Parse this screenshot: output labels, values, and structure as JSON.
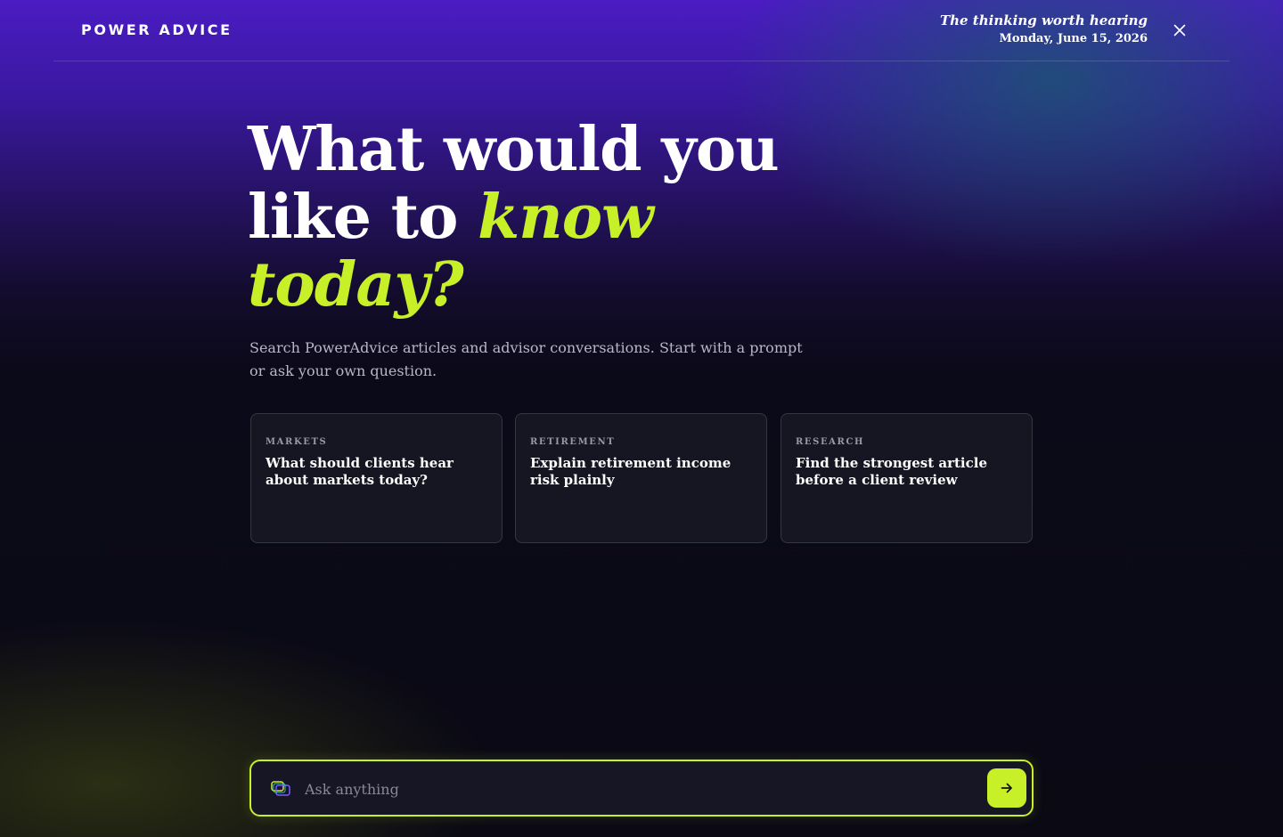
{
  "header": {
    "logo": "POWER ADVICE",
    "tagline": "The thinking worth hearing",
    "date": "Monday, June 15, 2026",
    "close_icon": "close-icon"
  },
  "hero": {
    "line1": "What would you",
    "line2_plain": "like to ",
    "line2_accent": "know",
    "line3_accent": "today?"
  },
  "subtitle": "Search PowerAdvice articles and advisor conversations. Start with a prompt or ask your own question.",
  "prompt_cards": [
    {
      "category": "MARKETS",
      "title": "What should clients hear about markets today?"
    },
    {
      "category": "RETIREMENT",
      "title": "Explain retirement income risk plainly"
    },
    {
      "category": "RESEARCH",
      "title": "Find the strongest article before a client review"
    }
  ],
  "ask_bar": {
    "placeholder": "Ask anything",
    "value": "",
    "icon": "chat-bubbles-icon",
    "send_icon": "arrow-right-icon"
  },
  "colors": {
    "accent": "#c8f028",
    "background": "#0a0914",
    "gradient_top": "#4a1cc2",
    "teal_glow": "#185c6c",
    "card_bg": "#181724"
  }
}
